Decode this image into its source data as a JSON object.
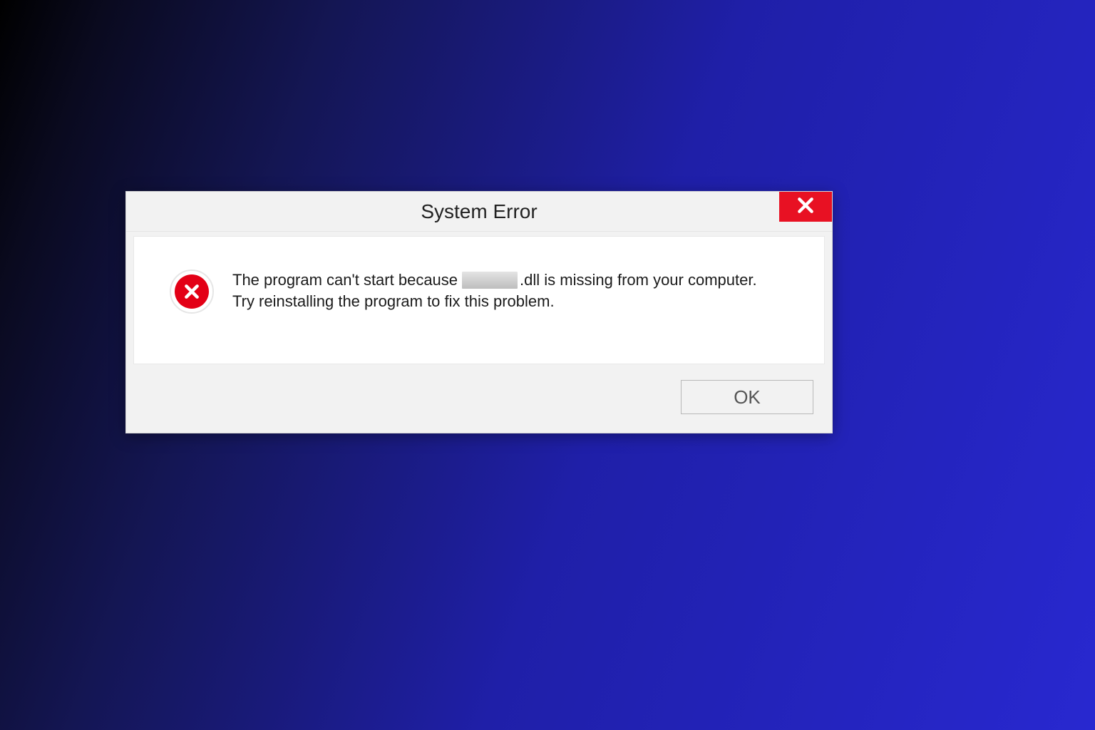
{
  "dialog": {
    "title": "System Error",
    "message_part1": "The program can't start because",
    "message_part2": ".dll is missing from your computer.",
    "message_line2": "Try reinstalling the program to fix this problem.",
    "ok_label": "OK"
  },
  "colors": {
    "close_button": "#e81123",
    "error_icon": "#e30016"
  }
}
